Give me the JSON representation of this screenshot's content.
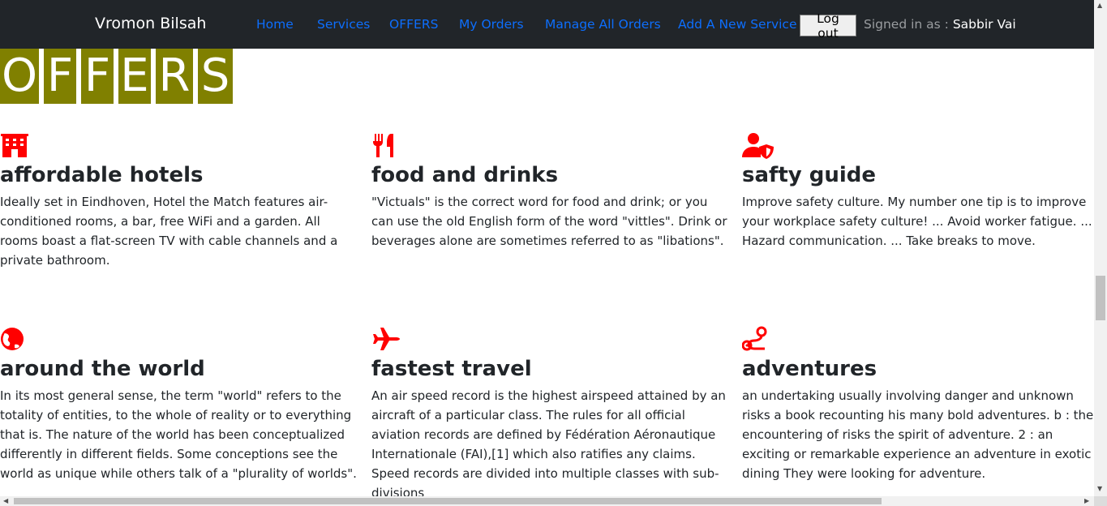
{
  "navbar": {
    "brand": "Vromon Bilsah",
    "links": [
      "Home",
      "Services",
      "OFFERS",
      "My Orders",
      "Manage All Orders",
      "Add A New Service"
    ],
    "logout_label": "Log out",
    "signed_in_prefix": "Signed in as :",
    "user_name": "Sabbir Vai"
  },
  "page": {
    "title_letters": [
      "O",
      "F",
      "F",
      "E",
      "R",
      "S"
    ]
  },
  "offers": [
    {
      "icon": "hotel-icon",
      "title": "affordable hotels",
      "text": "Ideally set in Eindhoven, Hotel the Match features air-conditioned rooms, a bar, free WiFi and a garden. All rooms boast a flat-screen TV with cable channels and a private bathroom."
    },
    {
      "icon": "utensils-icon",
      "title": "food and drinks",
      "text": "\"Victuals\" is the correct word for food and drink; or you can use the old English form of the word \"vittles\". Drink or beverages alone are sometimes referred to as \"libations\"."
    },
    {
      "icon": "user-shield-icon",
      "title": "safty guide",
      "text": "Improve safety culture. My number one tip is to improve your workplace safety culture! ... Avoid worker fatigue. ... Hazard communication. ... Take breaks to move."
    },
    {
      "icon": "globe-icon",
      "title": "around the world",
      "text": "In its most general sense, the term \"world\" refers to the totality of entities, to the whole of reality or to everything that is. The nature of the world has been conceptualized differently in different fields. Some conceptions see the world as unique while others talk of a \"plurality of worlds\"."
    },
    {
      "icon": "plane-icon",
      "title": "fastest travel",
      "text": "An air speed record is the highest airspeed attained by an aircraft of a particular class. The rules for all official aviation records are defined by Fédération Aéronautique Internationale (FAI),[1] which also ratifies any claims. Speed records are divided into multiple classes with sub-divisions"
    },
    {
      "icon": "route-icon",
      "title": "adventures",
      "text": "an undertaking usually involving danger and unknown risks a book recounting his many bold adventures. b : the encountering of risks the spirit of adventure. 2 : an exciting or remarkable experience an adventure in exotic dining They were looking for adventure."
    }
  ],
  "colors": {
    "navbar_bg": "#212529",
    "link": "#0d6efd",
    "offers_title_bg": "#808000",
    "icon": "#ff0000"
  }
}
